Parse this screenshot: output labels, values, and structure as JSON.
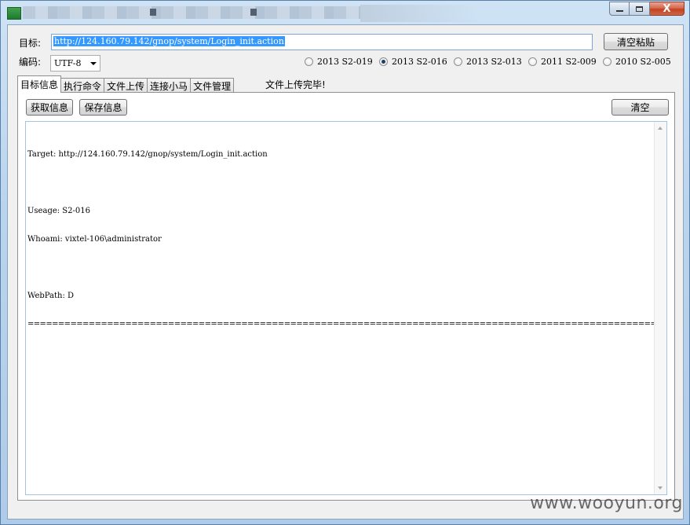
{
  "window": {
    "caption": {
      "close_glyph": "X"
    }
  },
  "form": {
    "target_label": "目标:",
    "target_url_selected": "http://124.160.79.142/gnop/system/Login_init.action",
    "clear_paste_label": "清空粘贴",
    "encoding_label": "编码:",
    "encoding_value": "UTF-8"
  },
  "exploits": [
    {
      "label": "2013 S2-019",
      "checked": false
    },
    {
      "label": "2013 S2-016",
      "checked": true
    },
    {
      "label": "2013 S2-013",
      "checked": false
    },
    {
      "label": "2011 S2-009",
      "checked": false
    },
    {
      "label": "2010 S2-005",
      "checked": false
    }
  ],
  "tabs": [
    {
      "label": "目标信息",
      "active": true
    },
    {
      "label": "执行命令",
      "active": false
    },
    {
      "label": "文件上传",
      "active": false
    },
    {
      "label": "连接小马",
      "active": false
    },
    {
      "label": "文件管理",
      "active": false
    }
  ],
  "status": "文件上传完毕!",
  "panel": {
    "get_info_label": "获取信息",
    "save_info_label": "保存信息",
    "clear_label": "清空"
  },
  "output": {
    "lines": [
      "Target: http://124.160.79.142/gnop/system/Login_init.action",
      "",
      "Useage: S2-016",
      "Whoami: vixtel-106\\administrator",
      "",
      "WebPath: D"
    ],
    "separator": "=============================================================================================================================================="
  },
  "watermark": "www.wooyun.org"
}
